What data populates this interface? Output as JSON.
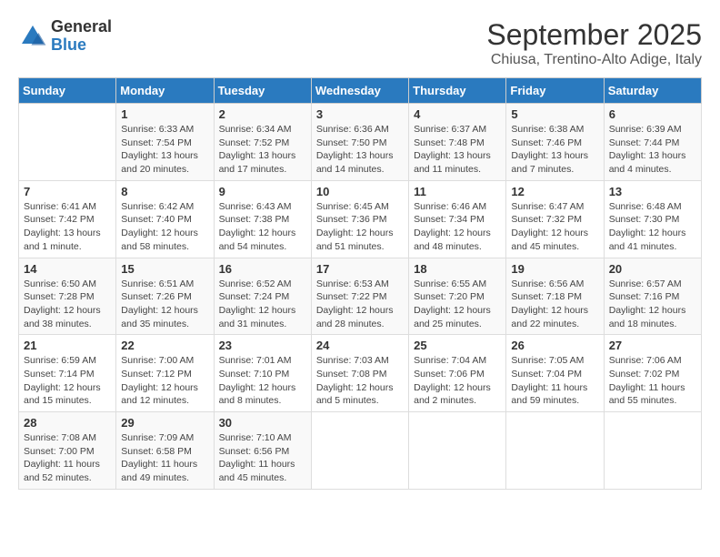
{
  "logo": {
    "general": "General",
    "blue": "Blue"
  },
  "title": "September 2025",
  "location": "Chiusa, Trentino-Alto Adige, Italy",
  "days_header": [
    "Sunday",
    "Monday",
    "Tuesday",
    "Wednesday",
    "Thursday",
    "Friday",
    "Saturday"
  ],
  "weeks": [
    [
      {
        "day": "",
        "info": ""
      },
      {
        "day": "1",
        "info": "Sunrise: 6:33 AM\nSunset: 7:54 PM\nDaylight: 13 hours\nand 20 minutes."
      },
      {
        "day": "2",
        "info": "Sunrise: 6:34 AM\nSunset: 7:52 PM\nDaylight: 13 hours\nand 17 minutes."
      },
      {
        "day": "3",
        "info": "Sunrise: 6:36 AM\nSunset: 7:50 PM\nDaylight: 13 hours\nand 14 minutes."
      },
      {
        "day": "4",
        "info": "Sunrise: 6:37 AM\nSunset: 7:48 PM\nDaylight: 13 hours\nand 11 minutes."
      },
      {
        "day": "5",
        "info": "Sunrise: 6:38 AM\nSunset: 7:46 PM\nDaylight: 13 hours\nand 7 minutes."
      },
      {
        "day": "6",
        "info": "Sunrise: 6:39 AM\nSunset: 7:44 PM\nDaylight: 13 hours\nand 4 minutes."
      }
    ],
    [
      {
        "day": "7",
        "info": "Sunrise: 6:41 AM\nSunset: 7:42 PM\nDaylight: 13 hours\nand 1 minute."
      },
      {
        "day": "8",
        "info": "Sunrise: 6:42 AM\nSunset: 7:40 PM\nDaylight: 12 hours\nand 58 minutes."
      },
      {
        "day": "9",
        "info": "Sunrise: 6:43 AM\nSunset: 7:38 PM\nDaylight: 12 hours\nand 54 minutes."
      },
      {
        "day": "10",
        "info": "Sunrise: 6:45 AM\nSunset: 7:36 PM\nDaylight: 12 hours\nand 51 minutes."
      },
      {
        "day": "11",
        "info": "Sunrise: 6:46 AM\nSunset: 7:34 PM\nDaylight: 12 hours\nand 48 minutes."
      },
      {
        "day": "12",
        "info": "Sunrise: 6:47 AM\nSunset: 7:32 PM\nDaylight: 12 hours\nand 45 minutes."
      },
      {
        "day": "13",
        "info": "Sunrise: 6:48 AM\nSunset: 7:30 PM\nDaylight: 12 hours\nand 41 minutes."
      }
    ],
    [
      {
        "day": "14",
        "info": "Sunrise: 6:50 AM\nSunset: 7:28 PM\nDaylight: 12 hours\nand 38 minutes."
      },
      {
        "day": "15",
        "info": "Sunrise: 6:51 AM\nSunset: 7:26 PM\nDaylight: 12 hours\nand 35 minutes."
      },
      {
        "day": "16",
        "info": "Sunrise: 6:52 AM\nSunset: 7:24 PM\nDaylight: 12 hours\nand 31 minutes."
      },
      {
        "day": "17",
        "info": "Sunrise: 6:53 AM\nSunset: 7:22 PM\nDaylight: 12 hours\nand 28 minutes."
      },
      {
        "day": "18",
        "info": "Sunrise: 6:55 AM\nSunset: 7:20 PM\nDaylight: 12 hours\nand 25 minutes."
      },
      {
        "day": "19",
        "info": "Sunrise: 6:56 AM\nSunset: 7:18 PM\nDaylight: 12 hours\nand 22 minutes."
      },
      {
        "day": "20",
        "info": "Sunrise: 6:57 AM\nSunset: 7:16 PM\nDaylight: 12 hours\nand 18 minutes."
      }
    ],
    [
      {
        "day": "21",
        "info": "Sunrise: 6:59 AM\nSunset: 7:14 PM\nDaylight: 12 hours\nand 15 minutes."
      },
      {
        "day": "22",
        "info": "Sunrise: 7:00 AM\nSunset: 7:12 PM\nDaylight: 12 hours\nand 12 minutes."
      },
      {
        "day": "23",
        "info": "Sunrise: 7:01 AM\nSunset: 7:10 PM\nDaylight: 12 hours\nand 8 minutes."
      },
      {
        "day": "24",
        "info": "Sunrise: 7:03 AM\nSunset: 7:08 PM\nDaylight: 12 hours\nand 5 minutes."
      },
      {
        "day": "25",
        "info": "Sunrise: 7:04 AM\nSunset: 7:06 PM\nDaylight: 12 hours\nand 2 minutes."
      },
      {
        "day": "26",
        "info": "Sunrise: 7:05 AM\nSunset: 7:04 PM\nDaylight: 11 hours\nand 59 minutes."
      },
      {
        "day": "27",
        "info": "Sunrise: 7:06 AM\nSunset: 7:02 PM\nDaylight: 11 hours\nand 55 minutes."
      }
    ],
    [
      {
        "day": "28",
        "info": "Sunrise: 7:08 AM\nSunset: 7:00 PM\nDaylight: 11 hours\nand 52 minutes."
      },
      {
        "day": "29",
        "info": "Sunrise: 7:09 AM\nSunset: 6:58 PM\nDaylight: 11 hours\nand 49 minutes."
      },
      {
        "day": "30",
        "info": "Sunrise: 7:10 AM\nSunset: 6:56 PM\nDaylight: 11 hours\nand 45 minutes."
      },
      {
        "day": "",
        "info": ""
      },
      {
        "day": "",
        "info": ""
      },
      {
        "day": "",
        "info": ""
      },
      {
        "day": "",
        "info": ""
      }
    ]
  ]
}
